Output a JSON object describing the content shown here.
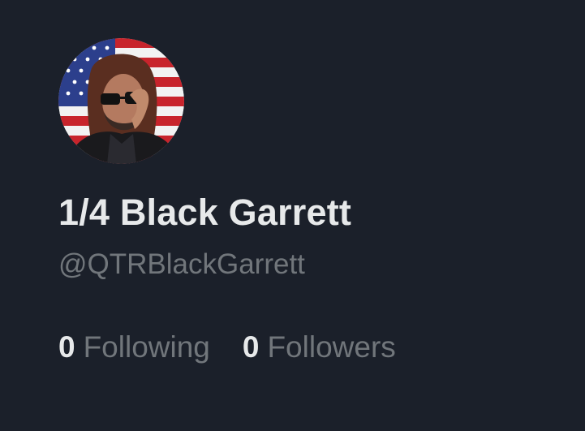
{
  "profile": {
    "display_name": "1/4 Black Garrett",
    "handle": "@QTRBlackGarrett",
    "avatar_icon": "avatar-photo-flag-background"
  },
  "stats": {
    "following_count": "0",
    "following_label": "Following",
    "followers_count": "0",
    "followers_label": "Followers"
  },
  "colors": {
    "background": "#1b202a",
    "primary_text": "#e7e9ea",
    "secondary_text": "#71767b"
  }
}
